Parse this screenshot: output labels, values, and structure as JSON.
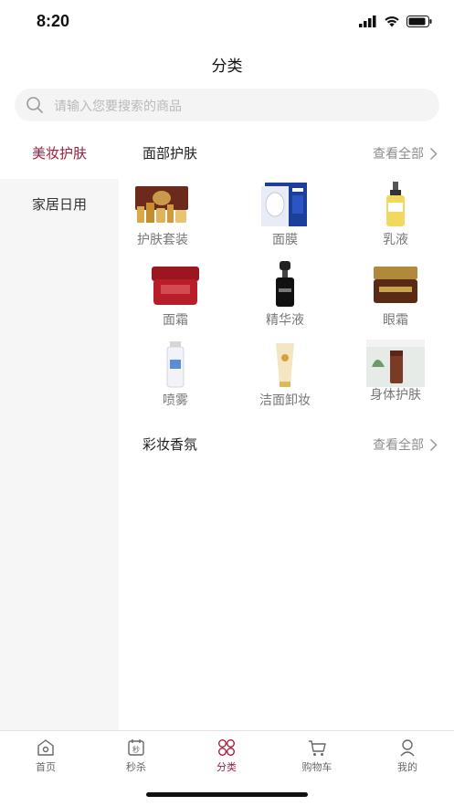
{
  "status_bar": {
    "time": "8:20"
  },
  "nav": {
    "title": "分类"
  },
  "search": {
    "placeholder": "请输入您要搜索的商品"
  },
  "sidebar": {
    "items": [
      {
        "label": "美妆护肤",
        "active": true
      },
      {
        "label": "家居日用",
        "active": false
      }
    ]
  },
  "sections": [
    {
      "title": "面部护肤",
      "see_all": "查看全部",
      "items": [
        {
          "label": "护肤套装",
          "icon": "gift-set-thumbnail"
        },
        {
          "label": "面膜",
          "icon": "face-mask-thumbnail"
        },
        {
          "label": "乳液",
          "icon": "lotion-bottle-thumbnail"
        },
        {
          "label": "面霜",
          "icon": "cream-jar-thumbnail"
        },
        {
          "label": "精华液",
          "icon": "serum-bottle-thumbnail"
        },
        {
          "label": "眼霜",
          "icon": "eye-cream-thumbnail"
        },
        {
          "label": "喷雾",
          "icon": "spray-bottle-thumbnail"
        },
        {
          "label": "洁面卸妆",
          "icon": "cleanser-tube-thumbnail"
        },
        {
          "label": "身体护肤",
          "icon": "body-care-thumbnail"
        }
      ]
    },
    {
      "title": "彩妆香氛",
      "see_all": "查看全部",
      "items": []
    }
  ],
  "tabbar": {
    "tabs": [
      {
        "label": "首页",
        "icon": "home-icon",
        "active": false
      },
      {
        "label": "秒杀",
        "icon": "flash-sale-icon",
        "active": false
      },
      {
        "label": "分类",
        "icon": "category-icon",
        "active": true
      },
      {
        "label": "购物车",
        "icon": "cart-icon",
        "active": false
      },
      {
        "label": "我的",
        "icon": "profile-icon",
        "active": false
      }
    ]
  },
  "colors": {
    "accent": "#a31d3c",
    "sidebar_bg": "#f6f6f6",
    "search_bg": "#f4f4f4"
  }
}
